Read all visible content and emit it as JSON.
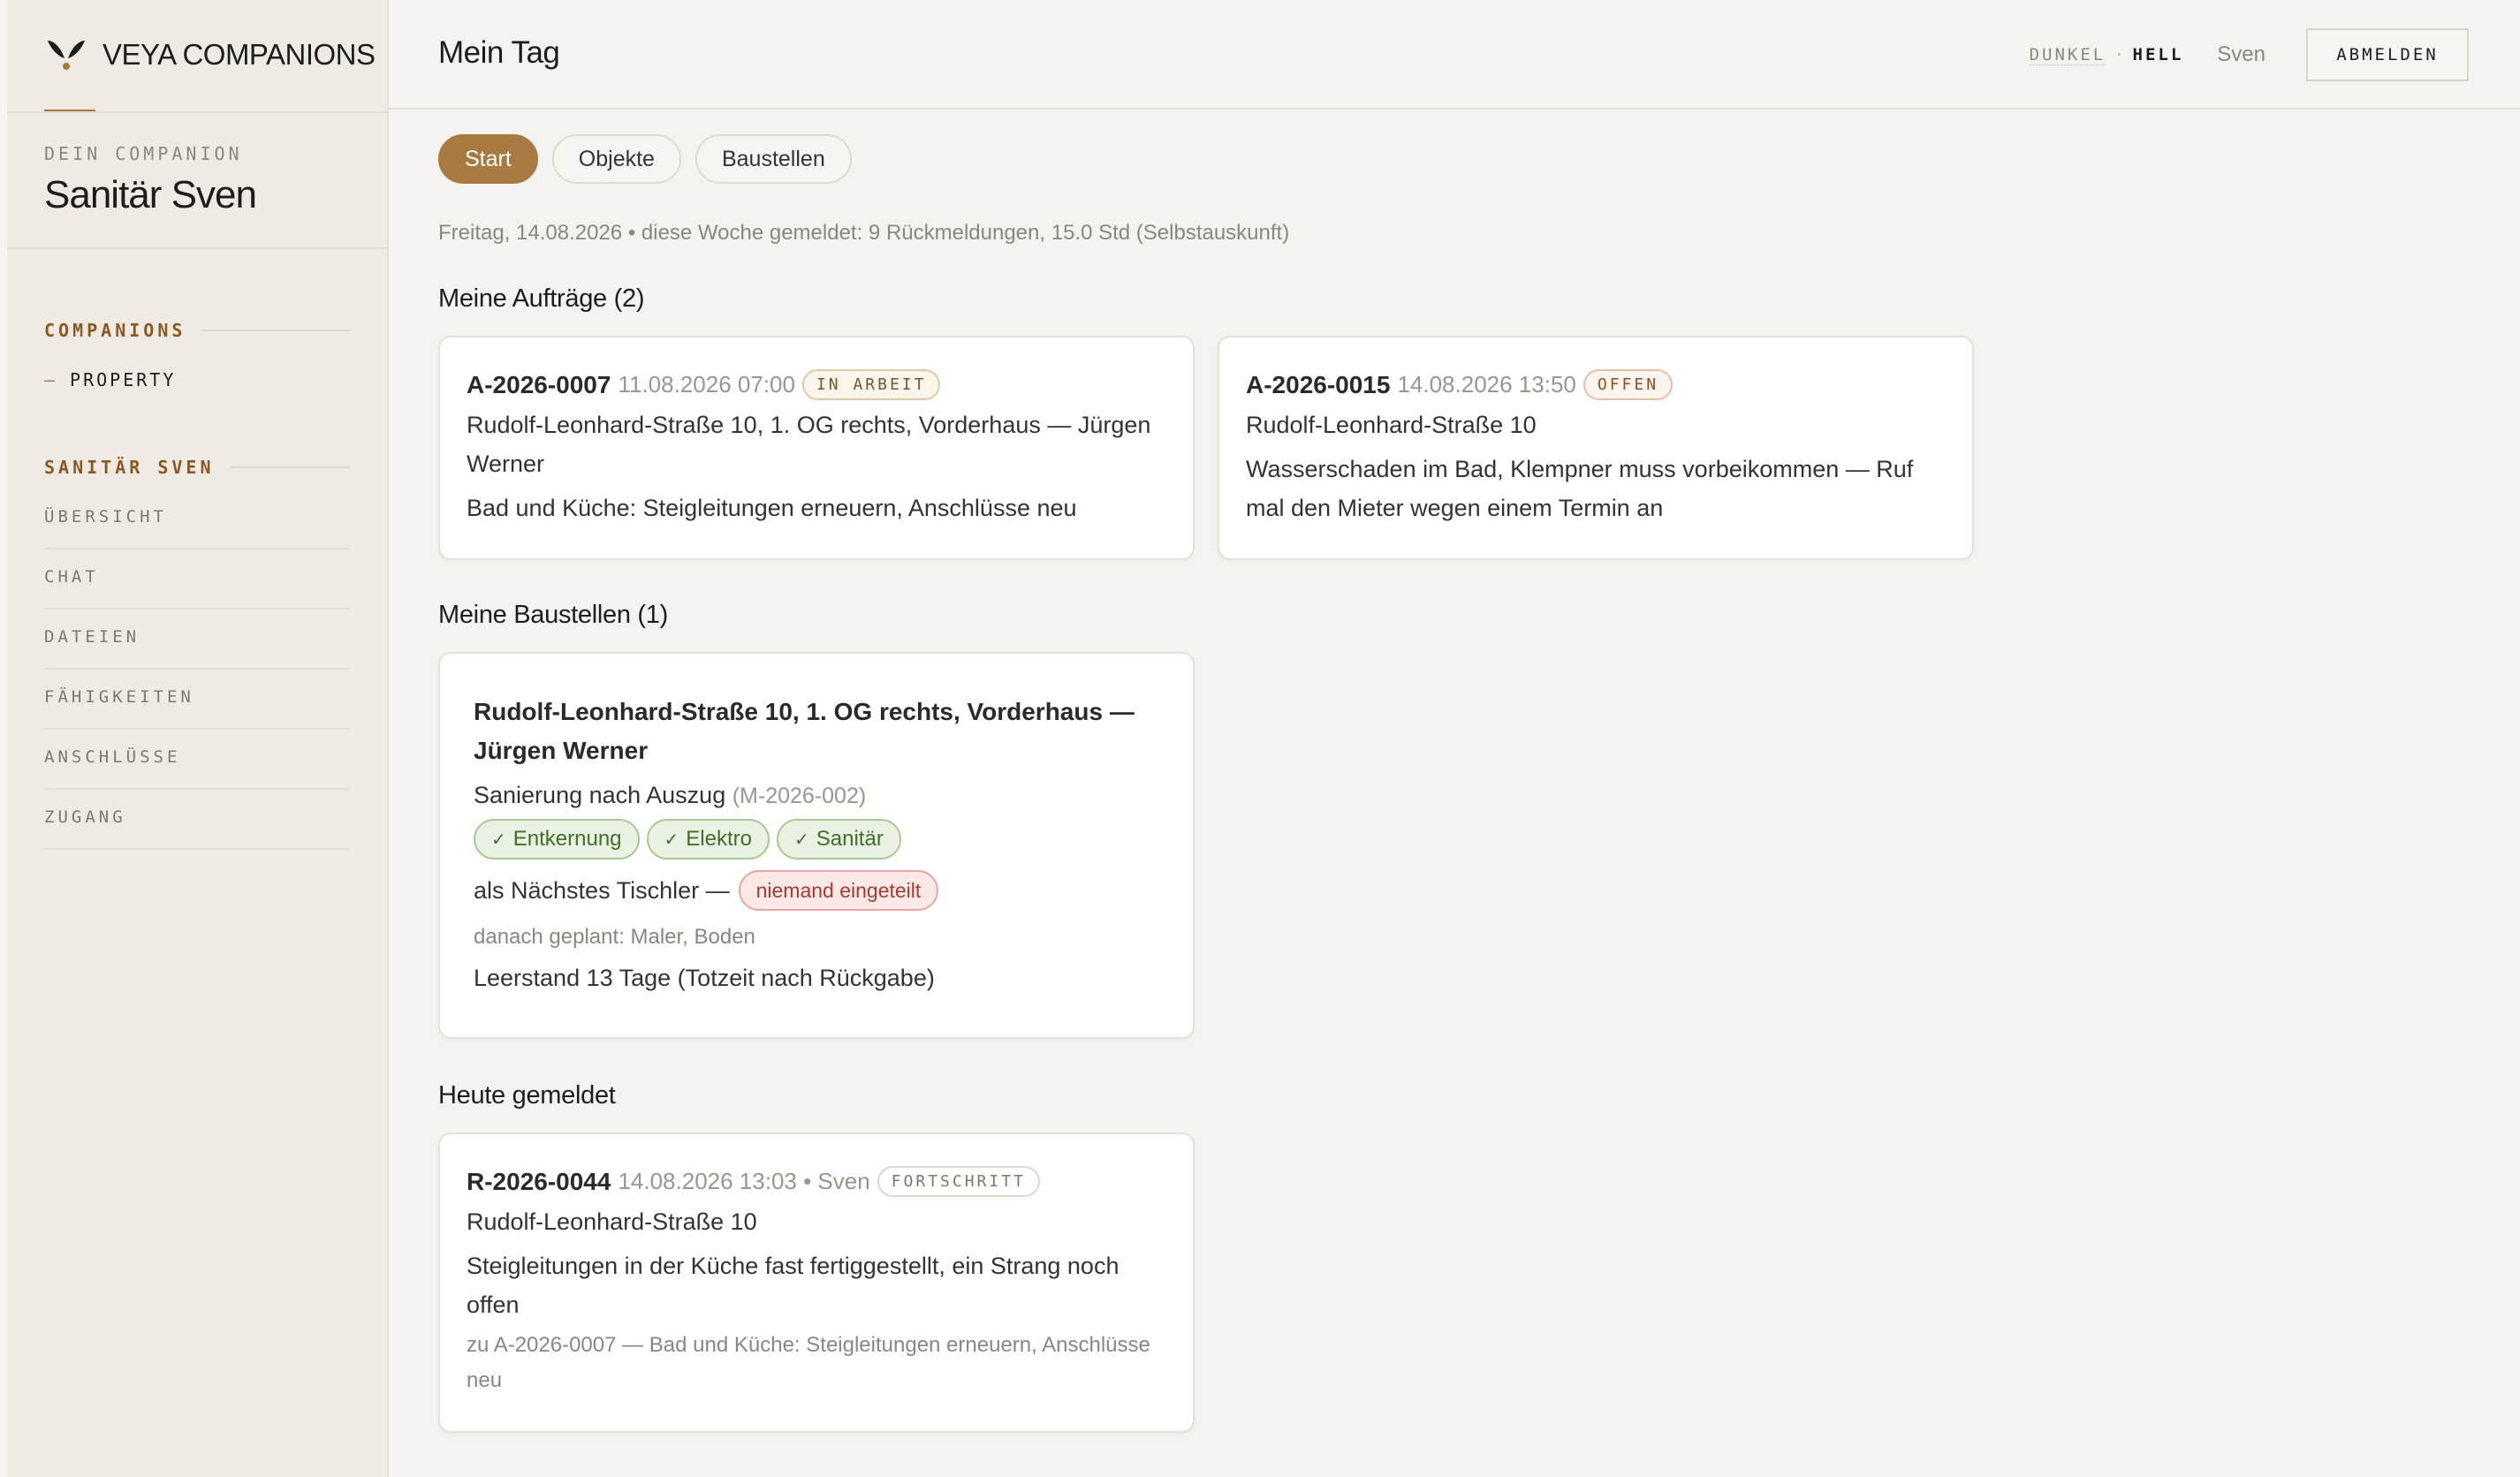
{
  "sidebar": {
    "brand": "VEYA COMPANIONS",
    "companion_label": "DEIN COMPANION",
    "companion_name": "Sanitär Sven",
    "sections": [
      {
        "title": "COMPANIONS",
        "items": [
          "PROPERTY"
        ]
      },
      {
        "title": "SANITÄR SVEN",
        "items": [
          "ÜBERSICHT",
          "CHAT",
          "DATEIEN",
          "FÄHIGKEITEN",
          "ANSCHLÜSSE",
          "ZUGANG"
        ]
      }
    ]
  },
  "header": {
    "title": "Mein Tag",
    "theme_dark": "DUNKEL",
    "theme_sep": "·",
    "theme_light": "HELL",
    "user": "Sven",
    "logout": "ABMELDEN"
  },
  "tabs": [
    "Start",
    "Objekte",
    "Baustellen"
  ],
  "meta": "Freitag, 14.08.2026 • diese Woche gemeldet: 9 Rückmeldungen, 15.0 Std (Selbstauskunft)",
  "auftraege": {
    "title": "Meine Aufträge (2)",
    "items": [
      {
        "id": "A-2026-0007",
        "timestamp": "11.08.2026 07:00",
        "status": "IN ARBEIT",
        "address": "Rudolf-Leonhard-Straße 10, 1. OG rechts, Vorderhaus — Jürgen Werner",
        "description": "Bad und Küche: Steigleitungen erneuern, Anschlüsse neu"
      },
      {
        "id": "A-2026-0015",
        "timestamp": "14.08.2026 13:50",
        "status": "OFFEN",
        "address": "Rudolf-Leonhard-Straße 10",
        "description": "Wasserschaden im Bad, Klempner muss vorbeikommen — Ruf mal den Mieter wegen einem Termin an"
      }
    ]
  },
  "baustellen": {
    "title": "Meine Baustellen (1)",
    "items": [
      {
        "title": "Rudolf-Leonhard-Straße 10, 1. OG rechts, Vorderhaus — Jürgen Werner",
        "project": "Sanierung nach Auszug",
        "project_id": "(M-2026-002)",
        "done": [
          "Entkernung",
          "Elektro",
          "Sanitär"
        ],
        "check": "✓",
        "next_label": "als Nächstes Tischler —",
        "next_status": "niemand eingeteilt",
        "planned": "danach geplant: Maler, Boden",
        "vacancy": "Leerstand 13 Tage (Totzeit nach Rückgabe)"
      }
    ]
  },
  "heute": {
    "title": "Heute gemeldet",
    "items": [
      {
        "id": "R-2026-0044",
        "timestamp": "14.08.2026 13:03 • Sven",
        "status": "FORTSCHRITT",
        "address": "Rudolf-Leonhard-Straße 10",
        "text": "Steigleitungen in der Küche fast fertiggestellt, ein Strang noch offen",
        "ref": "zu A-2026-0007 — Bad und Küche: Steigleitungen erneuern, Anschlüsse neu"
      }
    ]
  },
  "colors": {
    "accent": "#a87a42",
    "background": "#f5f3ef",
    "sidebar": "#efebe4",
    "success": "#3f6e2a",
    "danger": "#a53a30"
  }
}
